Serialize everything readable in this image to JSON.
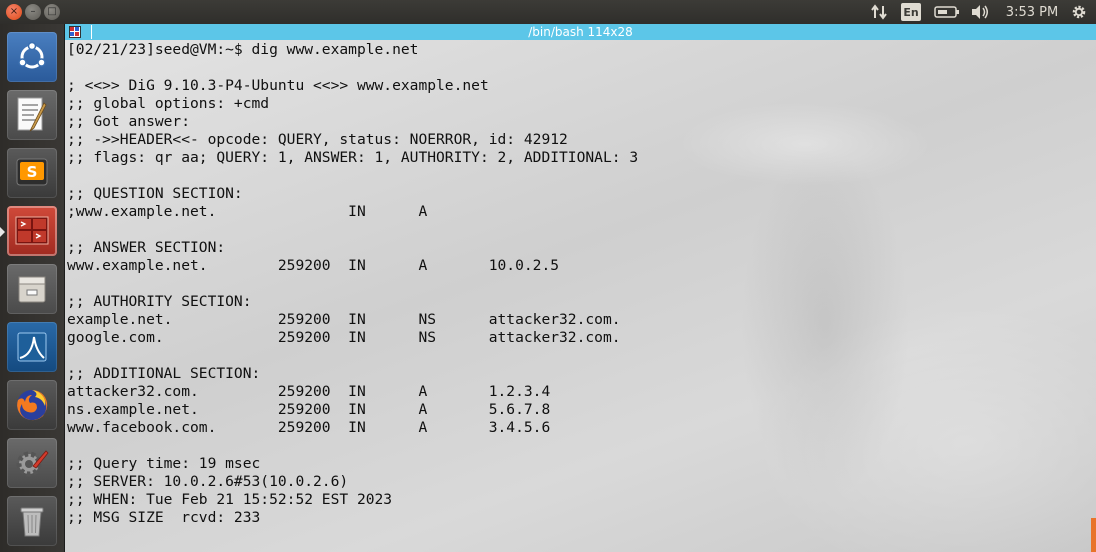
{
  "top_panel": {
    "window_buttons": {
      "close": "×",
      "minimize": "–",
      "maximize": "□"
    },
    "language": "En",
    "clock": "3:53 PM",
    "icons": [
      "network-updown-icon",
      "battery-icon",
      "volume-icon",
      "settings-gear-icon"
    ]
  },
  "launcher": {
    "items": [
      {
        "name": "ubuntu-dash-icon",
        "active": false
      },
      {
        "name": "text-editor-icon",
        "active": false
      },
      {
        "name": "sublime-text-icon",
        "active": false
      },
      {
        "name": "terminal-icon",
        "active": true
      },
      {
        "name": "file-manager-icon",
        "active": false
      },
      {
        "name": "wireshark-icon",
        "active": false
      },
      {
        "name": "firefox-icon",
        "active": false
      },
      {
        "name": "system-settings-icon",
        "active": false
      },
      {
        "name": "trash-icon",
        "active": false
      }
    ]
  },
  "terminal": {
    "title": "/bin/bash 114x28",
    "lines": [
      "[02/21/23]seed@VM:~$ dig www.example.net",
      "",
      "; <<>> DiG 9.10.3-P4-Ubuntu <<>> www.example.net",
      ";; global options: +cmd",
      ";; Got answer:",
      ";; ->>HEADER<<- opcode: QUERY, status: NOERROR, id: 42912",
      ";; flags: qr aa; QUERY: 1, ANSWER: 1, AUTHORITY: 2, ADDITIONAL: 3",
      "",
      ";; QUESTION SECTION:",
      ";www.example.net.               IN      A",
      "",
      ";; ANSWER SECTION:",
      "www.example.net.        259200  IN      A       10.0.2.5",
      "",
      ";; AUTHORITY SECTION:",
      "example.net.            259200  IN      NS      attacker32.com.",
      "google.com.             259200  IN      NS      attacker32.com.",
      "",
      ";; ADDITIONAL SECTION:",
      "attacker32.com.         259200  IN      A       1.2.3.4",
      "ns.example.net.         259200  IN      A       5.6.7.8",
      "www.facebook.com.       259200  IN      A       3.4.5.6",
      "",
      ";; Query time: 19 msec",
      ";; SERVER: 10.0.2.6#53(10.0.2.6)",
      ";; WHEN: Tue Feb 21 15:52:52 EST 2023",
      ";; MSG SIZE  rcvd: 233"
    ]
  },
  "colors": {
    "panel_bg": "#3c3b37",
    "terminal_titlebar": "#5cc6e8",
    "launcher_bg": "#2e2c29",
    "scroll_accent": "#e8732a"
  }
}
